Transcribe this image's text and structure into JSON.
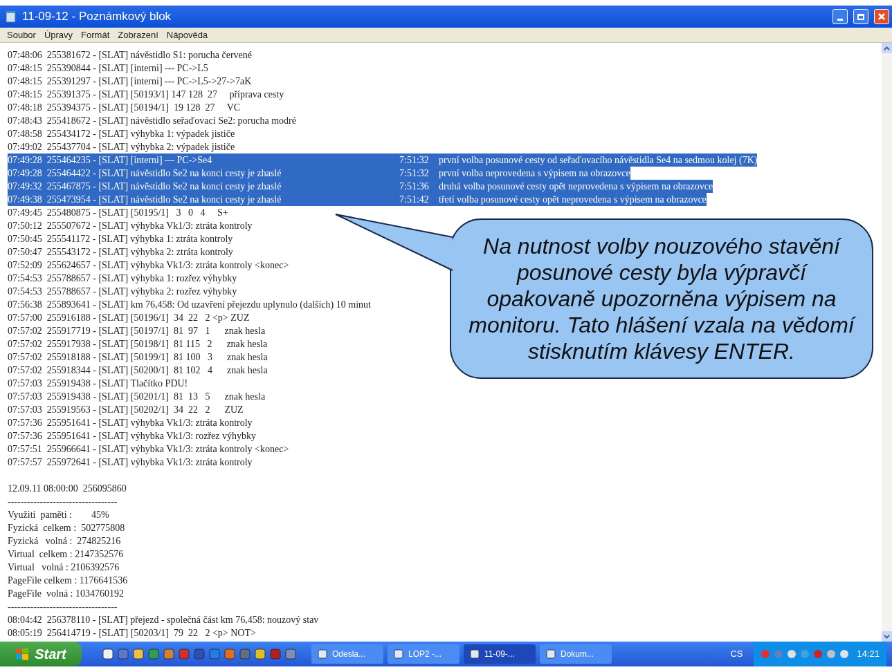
{
  "window": {
    "title": "11-09-12 - Poznámkový blok"
  },
  "menu": [
    "Soubor",
    "Úpravy",
    "Formát",
    "Zobrazení",
    "Nápověda"
  ],
  "blocks": [
    [
      {
        "text": "07:48:06  255381672 - [SLAT] návěstidlo S1: porucha červené",
        "selected": false
      },
      {
        "text": "07:48:15  255390844 - [SLAT] [interni] --- PC->L5",
        "selected": false
      },
      {
        "text": "07:48:15  255391297 - [SLAT] [interni] --- PC->L5->27->7aK",
        "selected": false
      },
      {
        "text": "07:48:15  255391375 - [SLAT] [50193/1] 147 128  27     příprava cesty",
        "selected": false
      },
      {
        "text": "07:48:18  255394375 - [SLAT] [50194/1]  19 128  27     VC",
        "selected": false
      },
      {
        "text": "07:48:43  255418672 - [SLAT] návěstidlo seřaďovací Se2: porucha modré",
        "selected": false
      },
      {
        "text": "07:48:58  255434172 - [SLAT] výhybka 1: výpadek jističe",
        "selected": false
      },
      {
        "text": "07:49:02  255437704 - [SLAT] výhybka 2: výpadek jističe",
        "selected": false
      },
      {
        "text": "07:49:28  255464235 - [SLAT] [interni] — PC->Se4",
        "selected": true,
        "note_time": "7:51:32",
        "note": "první volba posunové cesty od seřaďovacího návěstidla Se4 na sedmou kolej (7K)"
      },
      {
        "text": "07:49:28  255464422 - [SLAT] návěstidlo Se2 na konci cesty je zhaslé",
        "selected": true,
        "note_time": "7:51:32",
        "note": "první volba neprovedena s výpisem na obrazovce"
      },
      {
        "text": "07:49:32  255467875 - [SLAT] návěstidlo Se2 na konci cesty je zhaslé",
        "selected": true,
        "note_time": "7:51:36",
        "note": "druhá volba posunové cesty opět neprovedena s výpisem na obrazovce"
      },
      {
        "text": "07:49:38  255473954 - [SLAT] návěstidlo Se2 na konci cesty je zhaslé",
        "selected": true,
        "note_time": "7:51:42",
        "note": "třetí volba posunové cesty opět neprovedena s výpisem na obrazovce"
      },
      {
        "text": "07:49:45  255480875 - [SLAT] [50195/1]   3   0   4     S+",
        "selected": false
      },
      {
        "text": "07:50:12  255507672 - [SLAT] výhybka Vk1/3: ztráta kontroly",
        "selected": false
      },
      {
        "text": "07:50:45  255541172 - [SLAT] výhybka 1: ztráta kontroly",
        "selected": false
      },
      {
        "text": "07:50:47  255543172 - [SLAT] výhybka 2: ztráta kontroly",
        "selected": false
      },
      {
        "text": "07:52:09  255624657 - [SLAT] výhybka Vk1/3: ztráta kontroly <konec>",
        "selected": false
      },
      {
        "text": "07:54:53  255788657 - [SLAT] výhybka 1: rozřez výhybky",
        "selected": false
      },
      {
        "text": "07:54:53  255788657 - [SLAT] výhybka 2: rozřez výhybky",
        "selected": false
      },
      {
        "text": "07:56:38  255893641 - [SLAT] km 76,458: Od uzavření přejezdu uplynulo (dalších) 10 minut",
        "selected": false
      },
      {
        "text": "07:57:00  255916188 - [SLAT] [50196/1]  34  22   2 <p> ZUZ",
        "selected": false
      },
      {
        "text": "07:57:02  255917719 - [SLAT] [50197/1]  81  97   1      znak hesla",
        "selected": false
      },
      {
        "text": "07:57:02  255917938 - [SLAT] [50198/1]  81 115   2      znak hesla",
        "selected": false
      },
      {
        "text": "07:57:02  255918188 - [SLAT] [50199/1]  81 100   3      znak hesla",
        "selected": false
      },
      {
        "text": "07:57:02  255918344 - [SLAT] [50200/1]  81 102   4      znak hesla",
        "selected": false
      },
      {
        "text": "07:57:03  255919438 - [SLAT] Tlačítko PDU!",
        "selected": false
      },
      {
        "text": "07:57:03  255919438 - [SLAT] [50201/1]  81  13   5      znak hesla",
        "selected": false
      },
      {
        "text": "07:57:03  255919563 - [SLAT] [50202/1]  34  22   2      ZUZ",
        "selected": false
      },
      {
        "text": "07:57:36  255951641 - [SLAT] výhybka Vk1/3: ztráta kontroly",
        "selected": false
      },
      {
        "text": "07:57:36  255951641 - [SLAT] výhybka Vk1/3: rozřez výhybky",
        "selected": false
      },
      {
        "text": "07:57:51  255966641 - [SLAT] výhybka Vk1/3: ztráta kontroly <konec>",
        "selected": false
      },
      {
        "text": "07:57:57  255972641 - [SLAT] výhybka Vk1/3: ztráta kontroly",
        "selected": false
      }
    ],
    [
      {
        "text": "12.09.11 08:00:00  256095860",
        "selected": false
      },
      {
        "text": "----------------------------------",
        "selected": false
      },
      {
        "text": "Využití  paměti :        45%",
        "selected": false
      },
      {
        "text": "Fyzická  celkem :  502775808",
        "selected": false
      },
      {
        "text": "Fyzická   volná :  274825216",
        "selected": false
      },
      {
        "text": "Virtual  celkem : 2147352576",
        "selected": false
      },
      {
        "text": "Virtual   volná : 2106392576",
        "selected": false
      },
      {
        "text": "PageFile celkem : 1176641536",
        "selected": false
      },
      {
        "text": "PageFile  volná : 1034760192",
        "selected": false
      },
      {
        "text": "----------------------------------",
        "selected": false
      },
      {
        "text": "08:04:42  256378110 - [SLAT] přejezd - společná část km 76,458: nouzový stav",
        "selected": false
      },
      {
        "text": "08:05:19  256414719 - [SLAT] [50203/1]  79  22   2 <p> NOT>",
        "selected": false
      }
    ]
  ],
  "callout": "Na nutnost volby nouzového stavění posunové cesty byla výpravčí opakovaně upozorněna výpisem na monitoru. Tato hlášení vzala na vědomí stisknutím klávesy ENTER.",
  "taskbar": {
    "start": "Start",
    "tasks": [
      {
        "label": "Odesla...",
        "selected": false
      },
      {
        "label": "LOP2 -...",
        "selected": false
      },
      {
        "label": "11-09-...",
        "selected": true
      },
      {
        "label": "Dokum...",
        "selected": false
      }
    ],
    "language": "CS",
    "clock": "14:21"
  }
}
